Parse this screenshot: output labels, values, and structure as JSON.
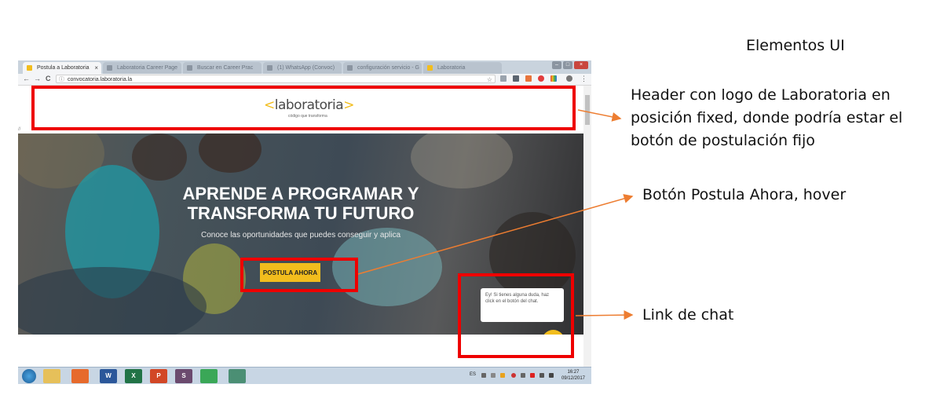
{
  "slide": {
    "title": "Elementos UI"
  },
  "browser": {
    "tabs": [
      {
        "label": "Postula a Laboratoria",
        "active": true
      },
      {
        "label": "Laboratoria Career Page",
        "active": false
      },
      {
        "label": "Buscar en Career Prac",
        "active": false
      },
      {
        "label": "(1) WhatsApp (Convoc)",
        "active": false
      },
      {
        "label": "configuración servicio - G",
        "active": false
      },
      {
        "label": "Laboratoria",
        "active": false
      }
    ],
    "close_glyph": "×",
    "url": "convocatoria.laboratoria.la",
    "nav": {
      "back": "←",
      "forward": "→",
      "reload": "C",
      "info": "ⓘ",
      "star": "☆",
      "menu": "⋮"
    },
    "window_buttons": [
      "–",
      "□",
      "×"
    ]
  },
  "site": {
    "logo": {
      "open": "<",
      "text": "laboratoria",
      "close": ">"
    },
    "tagline": "código que transforma",
    "marker": "//",
    "hero": {
      "title": "APRENDE A PROGRAMAR  Y TRANSFORMA TU FUTURO",
      "subtitle": "Conoce las oportunidades que puedes conseguir y aplica",
      "cta_label": "POSTULA AHORA"
    },
    "chat": {
      "bubble_text": "Ey! Si tienes alguna duda, haz click en el botón del chat."
    }
  },
  "taskbar": {
    "lang": "ES",
    "time": "16:27",
    "date": "09/12/2017",
    "icons": [
      {
        "name": "explorer-icon",
        "glyph": "",
        "color": "#e6c05a"
      },
      {
        "name": "firefox-icon",
        "glyph": "",
        "color": "#e66a2c"
      },
      {
        "name": "word-icon",
        "glyph": "W",
        "color": "#2b579a"
      },
      {
        "name": "excel-icon",
        "glyph": "X",
        "color": "#217346"
      },
      {
        "name": "powerpoint-icon",
        "glyph": "P",
        "color": "#d24726"
      },
      {
        "name": "slack-icon",
        "glyph": "S",
        "color": "#6b4a6e"
      },
      {
        "name": "chrome-icon",
        "glyph": "",
        "color": "#3aa757"
      },
      {
        "name": "atom-icon",
        "glyph": "",
        "color": "#4b8f74"
      }
    ]
  },
  "annotations": {
    "header_note": [
      "Header con logo de Laboratoria en",
      "posición fixed, donde podría estar el",
      "botón de postulación fijo"
    ],
    "button_note": "Botón Postula Ahora, hover",
    "chat_note": "Link de chat"
  },
  "colors": {
    "brand_yellow": "#f2bd1d",
    "annotation_red": "#ee0000",
    "arrow_orange": "#ed7d31"
  }
}
